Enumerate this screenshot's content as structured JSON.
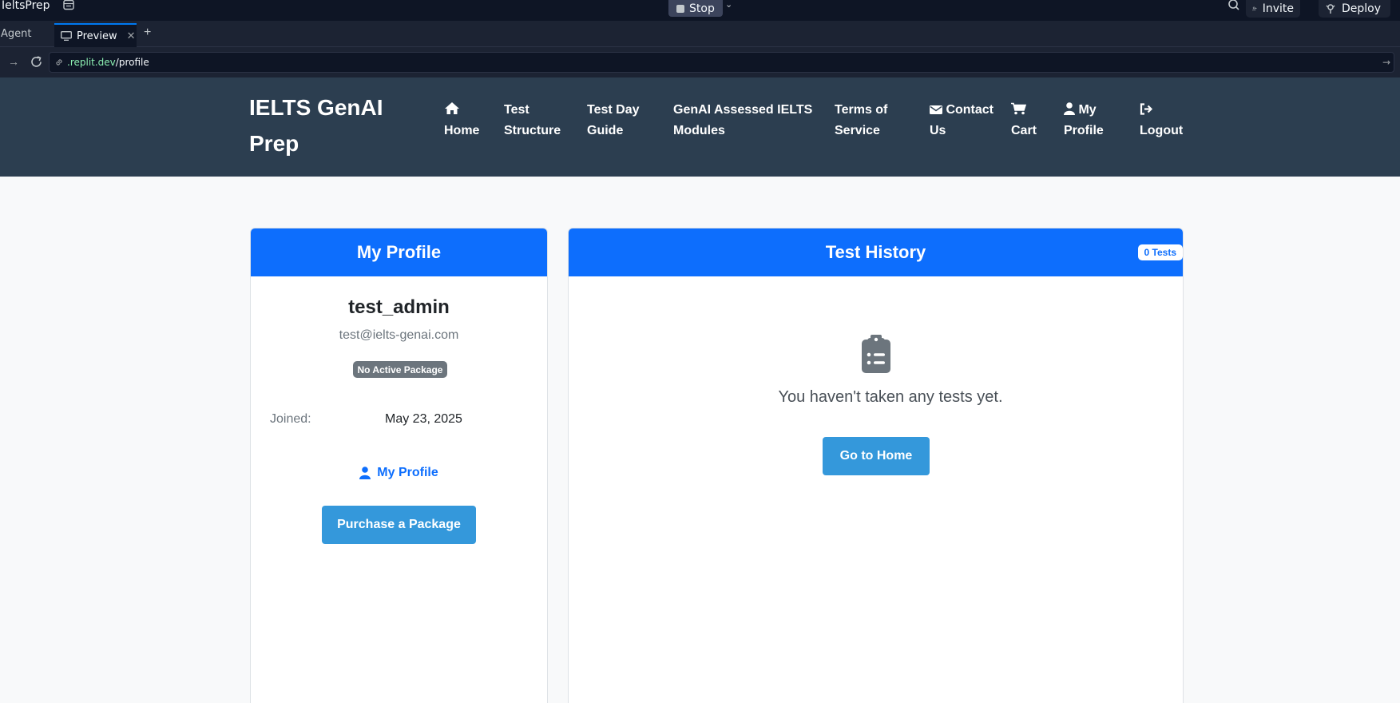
{
  "ide": {
    "app_name": "IeltsPrep",
    "stop_label": "Stop",
    "invite_label": "Invite",
    "deploy_label": "Deploy",
    "tabs": {
      "agent": "Agent",
      "preview": "Preview"
    },
    "url": {
      "host": ".replit.dev",
      "path": "/profile"
    }
  },
  "site": {
    "brand": "IELTS GenAI Prep",
    "nav": [
      {
        "label": "Home",
        "icon": "home-icon"
      },
      {
        "label": "Test Structure"
      },
      {
        "label": "Test Day Guide"
      },
      {
        "label": "GenAI Assessed IELTS Modules"
      },
      {
        "label": "Terms of Service"
      },
      {
        "label": "Contact Us",
        "icon": "envelope-icon"
      },
      {
        "label": "Cart",
        "icon": "cart-icon"
      },
      {
        "label": "My Profile",
        "icon": "user-icon"
      },
      {
        "label": "Logout",
        "icon": "sign-out-icon"
      }
    ]
  },
  "profile": {
    "title": "My Profile",
    "username": "test_admin",
    "email": "test@ielts-genai.com",
    "package_badge": "No Active Package",
    "joined_label": "Joined:",
    "joined_value": "May 23, 2025",
    "profile_link": "My Profile",
    "purchase_button": "Purchase a Package"
  },
  "history": {
    "title": "Test History",
    "count_badge": "0 Tests",
    "empty_message": "You haven't taken any tests yet.",
    "home_button": "Go to Home"
  },
  "colors": {
    "nav_bg": "#2c3e50",
    "card_header": "#0d6efd",
    "button": "#3498db",
    "badge_gray": "#6c757d"
  }
}
